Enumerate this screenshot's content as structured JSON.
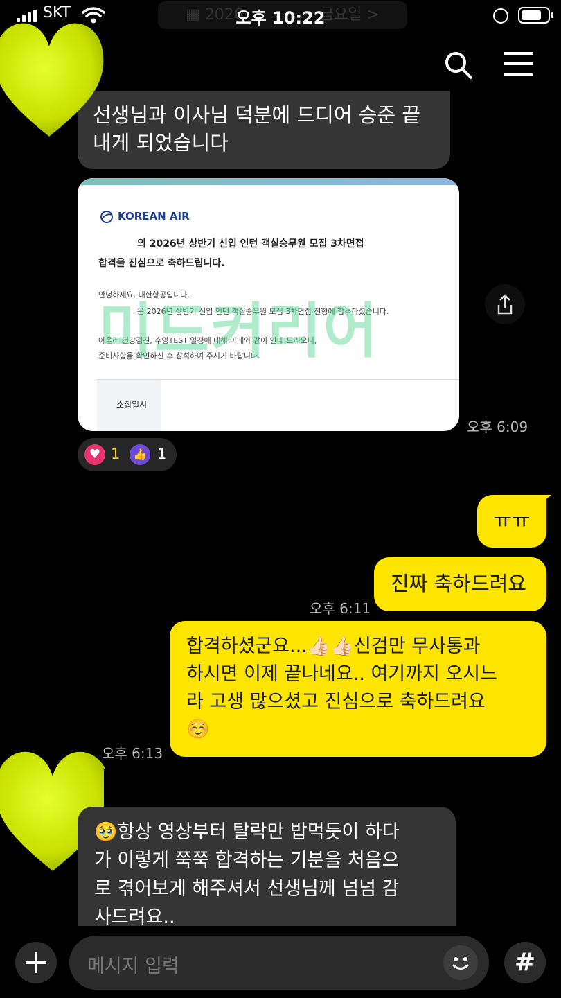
{
  "status_bar": {
    "carrier": "SKT",
    "time": "오후 10:22",
    "date_pill": "2026",
    "date_pill_right": "금요일 >"
  },
  "messages": [
    {
      "text": "선생님과 이사님 덕분에 드디어 승준 끝\n내게 되었습니다",
      "side": "left"
    },
    {
      "image": {
        "brand": "KOREAN AIR",
        "headline_line1": "의 2026년 상반기 신입 인턴 객실승무원 모집 3차면접",
        "headline_line2": "합격을 진심으로 축하드립니다.",
        "body_line1": "안녕하세요. 대한항공입니다.",
        "body_line2": "은 2026년 상반기 신입 인턴 객실승무원 모집 3차면접 전형에 합격하셨습니다.",
        "body_line3": "아울러 건강검진, 수영TEST 일정에 대해 아래와 같이 안내 드리오니,",
        "body_line4": "준비사항을 확인하신 후 참석하여 주시기 바랍니다.",
        "table_label": "소집일시",
        "watermark": "미드커리어"
      },
      "time": "오후 6:09"
    },
    {
      "text": "ㅠㅠ",
      "side": "right"
    },
    {
      "text": "진짜 축하드려요",
      "side": "right",
      "time": "오후 6:11"
    },
    {
      "text": "합격하셨군요...👍🏻👍🏻신검만 무사통과\n하시면 이제 끝나네요.. 여기까지 오시느\n라 고생 많으셨고 진심으로 축하드려요\n☺️",
      "side": "right",
      "time": "오후 6:13"
    },
    {
      "text": "🥹항상 영상부터 탈락만 밥먹듯이 하다\n가 이렇게 쭉쭉 합격하는 기분을 처음으\n로 겪어보게 해주셔서 선생님께 넘넘 감\n사드려요..",
      "side": "left"
    }
  ],
  "reactions": {
    "heart_count": "1",
    "like_count": "1"
  },
  "input_bar": {
    "placeholder": "메시지 입력"
  },
  "colors": {
    "yellow": "#fee500",
    "gray_bubble": "#353535",
    "heart": "#e8336e",
    "like": "#6c4bd8",
    "sticker": "#c7e000"
  }
}
